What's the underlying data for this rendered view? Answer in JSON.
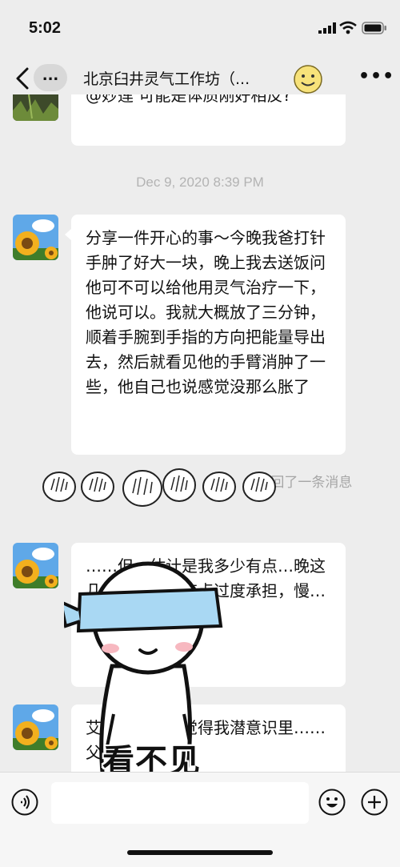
{
  "status_bar": {
    "time": "5:02"
  },
  "nav": {
    "back_icon": "chevron-left-icon",
    "pill_label": "...",
    "title": "北京臼井灵气工作坊（...",
    "more_label": "•••"
  },
  "messages": {
    "top_partial_text": "@妙莲 可能是体质刚好相反?",
    "timestamp": "Dec 9, 2020 8:39 PM",
    "msg1_text": "分享一件开心的事～今晚我爸打针手肿了好大一块，晚上我去送饭问他可不可以给他用灵气治疗一下，他说可以。我就大概放了三分钟，顺着手腕到手指的方向把能量导出去，然后就看见他的手臂消肿了一些，他自己也说感觉没那么胀了",
    "recall_prefix": "\"",
    "recall_suffix": "\" 撤回了一条消息",
    "msg2_text": "……但一估计是我多少有点…晚这几天病情加…有点过度承担，慢…自己胃里好堵感觉",
    "msg3_text": "艾米老师，我觉得我潜意识里……父母的拯救者和"
  },
  "sticker": {
    "caption": "看不见"
  },
  "input_bar": {
    "placeholder": ""
  },
  "colors": {
    "background": "#ededed",
    "bubble": "#ffffff",
    "timestamp": "#b3b3b3"
  }
}
